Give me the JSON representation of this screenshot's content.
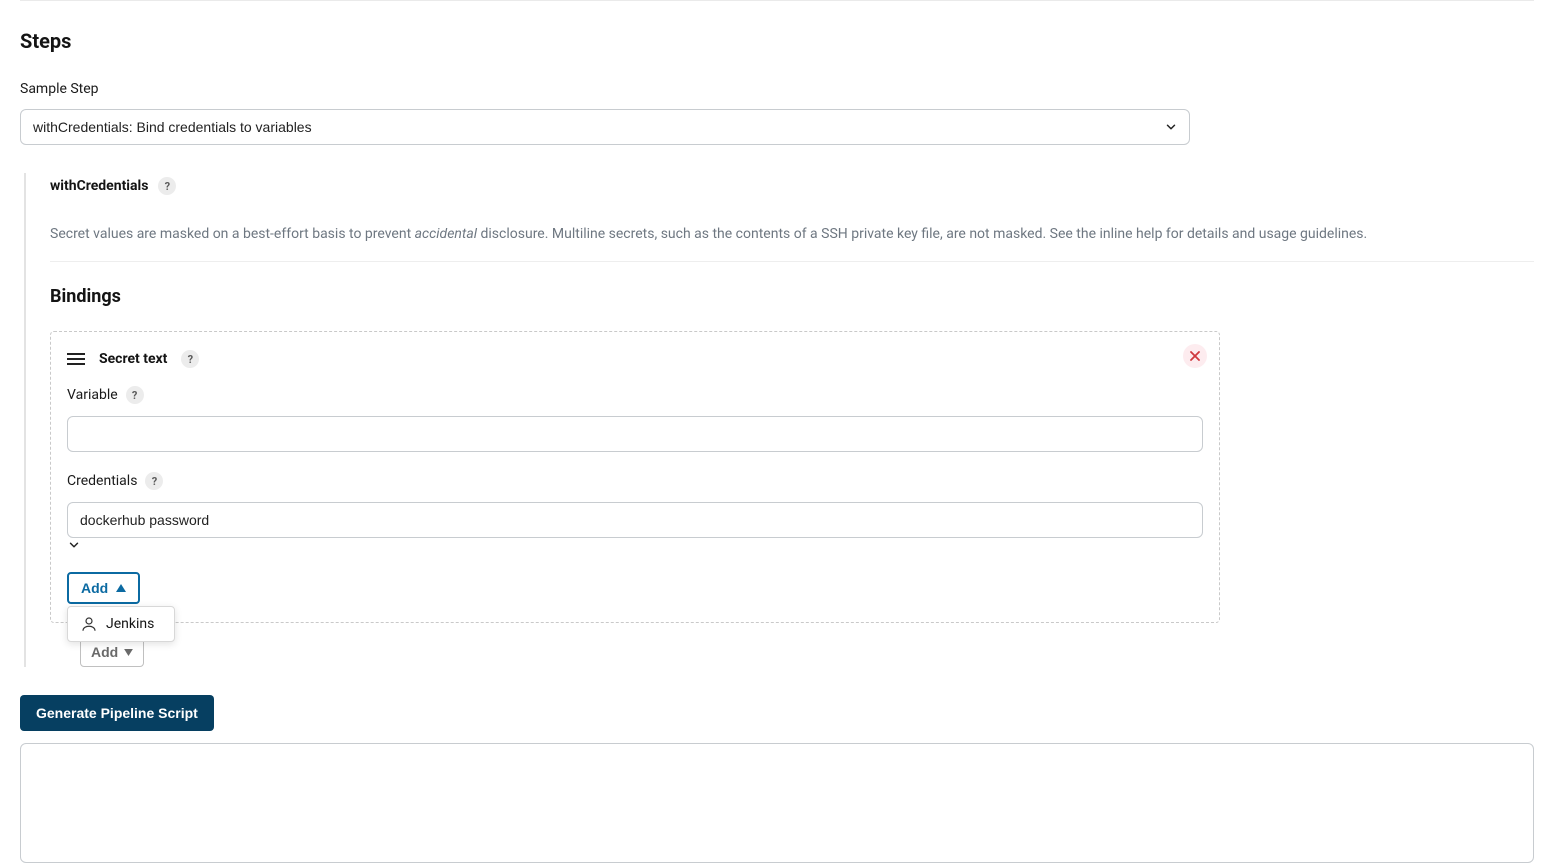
{
  "section": {
    "title": "Steps",
    "sample_step_label": "Sample Step",
    "sample_step_value": "withCredentials: Bind credentials to variables"
  },
  "step_detail": {
    "name": "withCredentials",
    "description_pre": "Secret values are masked on a best-effort basis to prevent ",
    "description_em": "accidental",
    "description_post": " disclosure. Multiline secrets, such as the contents of a SSH private key file, are not masked. See the inline help for details and usage guidelines."
  },
  "bindings": {
    "title": "Bindings",
    "item": {
      "type_label": "Secret text",
      "variable_label": "Variable",
      "variable_value": "",
      "credentials_label": "Credentials",
      "credentials_value": "dockerhub password"
    },
    "add_cred_label": "Add",
    "dropdown_option": "Jenkins",
    "add_outer_label": "Add"
  },
  "actions": {
    "generate_label": "Generate Pipeline Script"
  },
  "help_glyph": "?"
}
